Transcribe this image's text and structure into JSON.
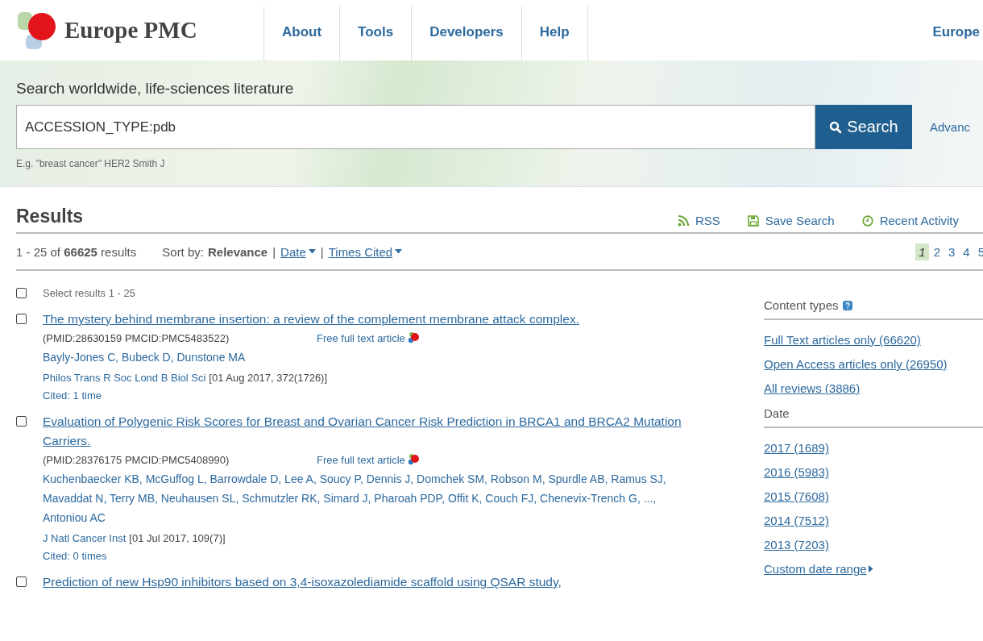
{
  "header": {
    "logo_text": "Europe PMC",
    "nav": [
      "About",
      "Tools",
      "Developers",
      "Help"
    ],
    "right_link": "Europe"
  },
  "search": {
    "heading": "Search worldwide, life-sciences literature",
    "value": "ACCESSION_TYPE:pdb",
    "button": "Search",
    "advanced": "Advanc",
    "hint": "E.g. \"breast cancer\" HER2 Smith J"
  },
  "results": {
    "title": "Results",
    "actions": [
      {
        "kind": "rss",
        "label": "RSS"
      },
      {
        "kind": "save",
        "label": "Save Search"
      },
      {
        "kind": "clock",
        "label": "Recent Activity"
      }
    ],
    "summary": "1 - 25 of **66625** results",
    "sort_label": "Sort by:",
    "sort_separators": [
      "|",
      "|"
    ],
    "sort_options": [
      {
        "label": "Relevance",
        "selected": true
      },
      {
        "label": "Date",
        "selected": false
      },
      {
        "label": "Times Cited",
        "selected": false
      }
    ],
    "pages": [
      {
        "label": "1",
        "selected": true
      },
      {
        "label": "2",
        "selected": false
      },
      {
        "label": "3",
        "selected": false
      },
      {
        "label": "4",
        "selected": false
      },
      {
        "label": "5",
        "selected": false
      }
    ],
    "select_all": {
      "label": "Select results 1 - 25",
      "checked": false
    },
    "articles": [
      {
        "checked": false,
        "title": "The mystery behind membrane insertion: a review of the complement membrane attack complex.",
        "ids": "(PMID:28630159 PMCID:PMC5483522)",
        "free_text": "Free full text article",
        "authors": "Bayly-Jones C, Bubeck D, Dunstone MA",
        "journal": "Philos Trans R Soc Lond B Biol Sci",
        "citation": "[01 Aug 2017, 372(1726)]",
        "cited": "Cited: 1 time"
      },
      {
        "checked": false,
        "title": "Evaluation of Polygenic Risk Scores for Breast and Ovarian Cancer Risk Prediction in BRCA1 and BRCA2 Mutation Carriers.",
        "ids": "(PMID:28376175 PMCID:PMC5408990)",
        "free_text": "Free full text article",
        "authors": "Kuchenbaecker KB, McGuffog L, Barrowdale D, Lee A, Soucy P, Dennis J, Domchek SM, Robson M, Spurdle AB, Ramus SJ, Mavaddat N, Terry MB, Neuhausen SL, Schmutzler RK, Simard J, Pharoah PDP, Offit K, Couch FJ, Chenevix-Trench G, ..., Antoniou AC",
        "journal": "J Natl Cancer Inst",
        "citation": "[01 Jul 2017, 109(7)]",
        "cited": "Cited: 0 times"
      },
      {
        "checked": false,
        "title": "Prediction of new Hsp90 inhibitors based on 3,4-isoxazolediamide scaffold using QSAR study,"
      }
    ]
  },
  "sidebar": [
    {
      "heading": "Content types",
      "help": true,
      "links": [
        "Full Text articles only (66620)",
        "Open Access articles only (26950)",
        "All reviews (3886)"
      ]
    },
    {
      "heading": "Date",
      "links": [
        "2017 (1689)",
        "2016 (5983)",
        "2015 (7608)",
        "2014 (7512)",
        "2013 (7203)"
      ],
      "more": "Custom date range"
    }
  ]
}
